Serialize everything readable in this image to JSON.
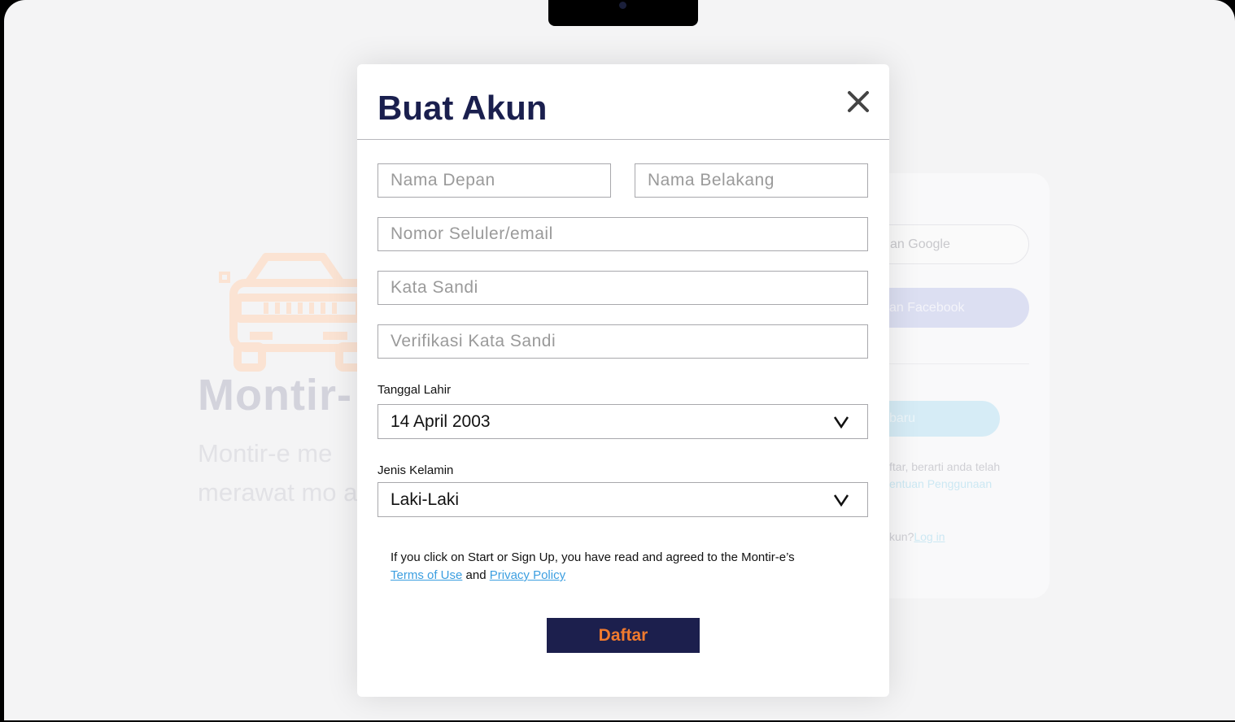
{
  "background": {
    "brand_name": "Montir-",
    "tagline": "Montir-e me merawat mo anda",
    "login_card": {
      "google_label": "an Google",
      "facebook_label": "an Facebook",
      "register_label": "baru",
      "terms_line1": "ftar, berarti anda telah",
      "terms_line2": "entuan Penggunaan",
      "account_prefix": "kun?",
      "login_link": "Log in"
    }
  },
  "modal": {
    "title": "Buat Akun",
    "fields": {
      "first_name_placeholder": "Nama Depan",
      "last_name_placeholder": "Nama Belakang",
      "contact_placeholder": "Nomor Seluler/email",
      "password_placeholder": "Kata Sandi",
      "verify_password_placeholder": "Verifikasi Kata Sandi"
    },
    "birthdate": {
      "label": "Tanggal Lahir",
      "value": "14 April 2003"
    },
    "gender": {
      "label": "Jenis Kelamin",
      "value": "Laki-Laki"
    },
    "consent": {
      "text": "If you click on Start or Sign Up, you have read and agreed to the Montir-e’s",
      "terms_link": "Terms of Use",
      "and": "and",
      "privacy_link": "Privacy Policy"
    },
    "submit_label": "Daftar"
  },
  "colors": {
    "title": "#1a1f4e",
    "submit_bg": "#1c1f4d",
    "submit_text": "#f07a2e",
    "link": "#3b9ee0"
  }
}
